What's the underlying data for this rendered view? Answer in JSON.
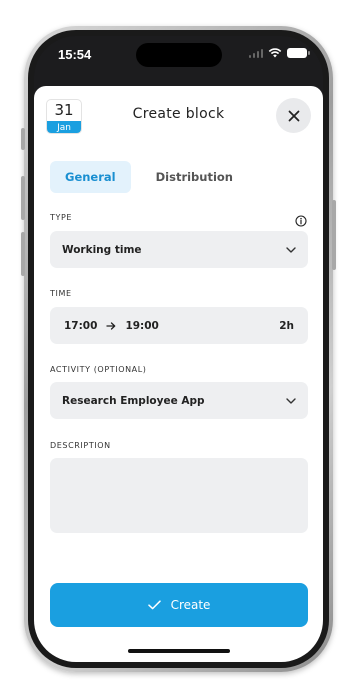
{
  "status_bar": {
    "time": "15:54"
  },
  "header": {
    "date_day": "31",
    "date_month": "Jan",
    "title": "Create block"
  },
  "tabs": [
    {
      "label": "General",
      "active": true
    },
    {
      "label": "Distribution",
      "active": false
    }
  ],
  "type": {
    "label": "TYPE",
    "value": "Working time"
  },
  "time": {
    "label": "TIME",
    "start": "17:00",
    "end": "19:00",
    "duration": "2h"
  },
  "activity": {
    "label": "ACTIVITY (OPTIONAL)",
    "value": "Research Employee App"
  },
  "description": {
    "label": "DESCRIPTION",
    "value": ""
  },
  "create_button": {
    "label": "Create"
  },
  "colors": {
    "accent": "#1a9fe0",
    "tab_active_bg": "#e3f2fc",
    "field_bg": "#eeeff1"
  },
  "icons": [
    "close-icon",
    "info-icon",
    "chevron-down-icon",
    "arrow-right-icon",
    "checkmark-icon",
    "wifi-icon",
    "battery-icon",
    "signal-icon"
  ]
}
